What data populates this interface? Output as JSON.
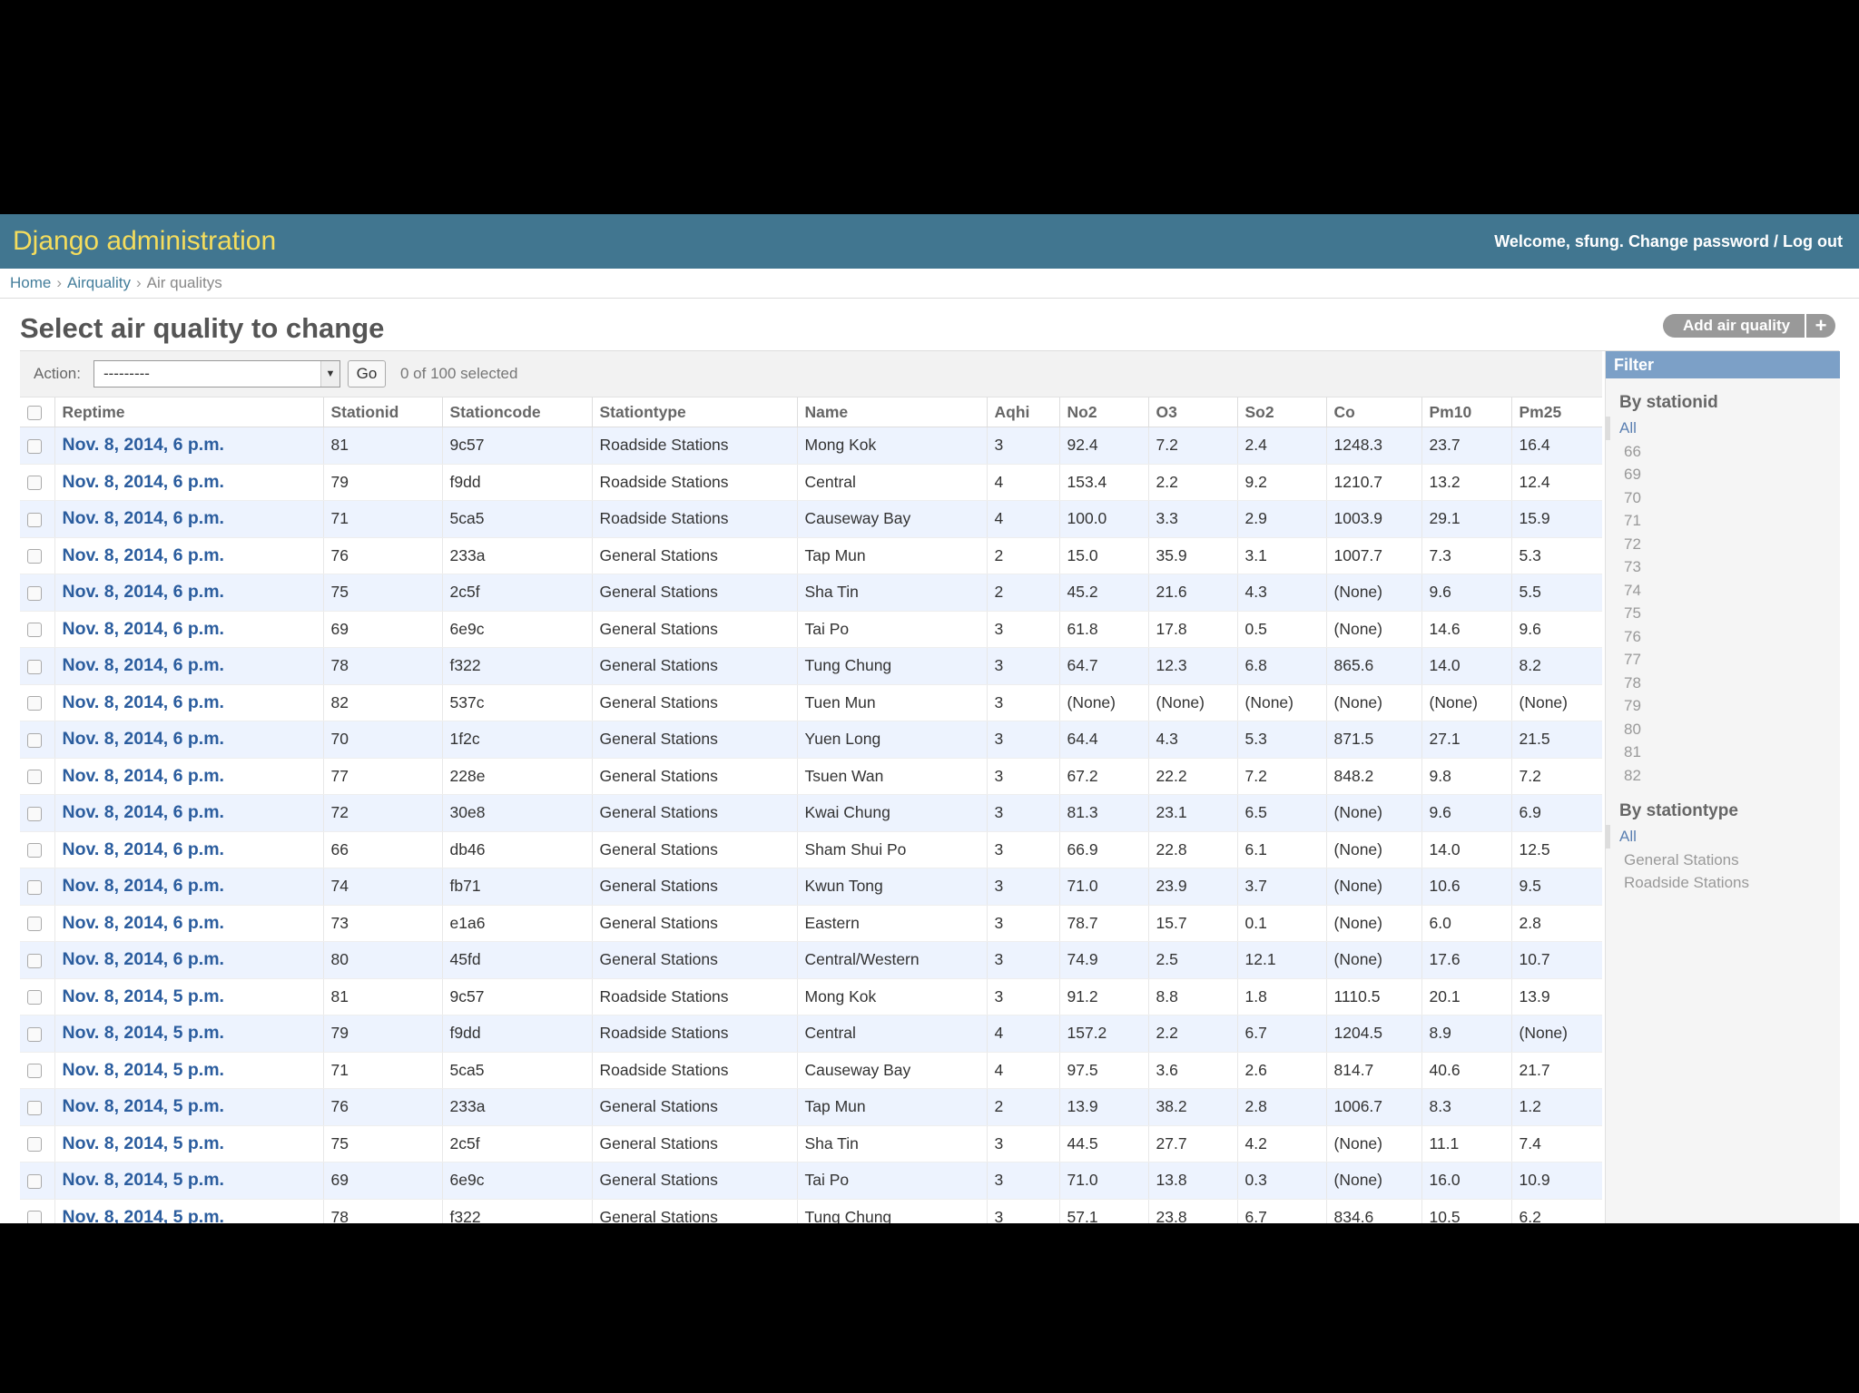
{
  "header": {
    "site_title": "Django administration",
    "welcome": "Welcome,",
    "username": "sfung",
    "change_password": "Change password",
    "separator": "/",
    "logout": "Log out"
  },
  "breadcrumbs": [
    "Home",
    "Airquality",
    "Air qualitys"
  ],
  "content": {
    "title": "Select air quality to change",
    "add_button": "Add air quality",
    "add_symbol": "+"
  },
  "actions": {
    "label": "Action:",
    "select_value": "---------",
    "go": "Go",
    "selected": "0 of 100 selected"
  },
  "table": {
    "columns": [
      "Reptime",
      "Stationid",
      "Stationcode",
      "Stationtype",
      "Name",
      "Aqhi",
      "No2",
      "O3",
      "So2",
      "Co",
      "Pm10",
      "Pm25"
    ],
    "rows": [
      [
        "Nov. 8, 2014, 6 p.m.",
        "81",
        "9c57",
        "Roadside Stations",
        "Mong Kok",
        "3",
        "92.4",
        "7.2",
        "2.4",
        "1248.3",
        "23.7",
        "16.4"
      ],
      [
        "Nov. 8, 2014, 6 p.m.",
        "79",
        "f9dd",
        "Roadside Stations",
        "Central",
        "4",
        "153.4",
        "2.2",
        "9.2",
        "1210.7",
        "13.2",
        "12.4"
      ],
      [
        "Nov. 8, 2014, 6 p.m.",
        "71",
        "5ca5",
        "Roadside Stations",
        "Causeway Bay",
        "4",
        "100.0",
        "3.3",
        "2.9",
        "1003.9",
        "29.1",
        "15.9"
      ],
      [
        "Nov. 8, 2014, 6 p.m.",
        "76",
        "233a",
        "General Stations",
        "Tap Mun",
        "2",
        "15.0",
        "35.9",
        "3.1",
        "1007.7",
        "7.3",
        "5.3"
      ],
      [
        "Nov. 8, 2014, 6 p.m.",
        "75",
        "2c5f",
        "General Stations",
        "Sha Tin",
        "2",
        "45.2",
        "21.6",
        "4.3",
        "(None)",
        "9.6",
        "5.5"
      ],
      [
        "Nov. 8, 2014, 6 p.m.",
        "69",
        "6e9c",
        "General Stations",
        "Tai Po",
        "3",
        "61.8",
        "17.8",
        "0.5",
        "(None)",
        "14.6",
        "9.6"
      ],
      [
        "Nov. 8, 2014, 6 p.m.",
        "78",
        "f322",
        "General Stations",
        "Tung Chung",
        "3",
        "64.7",
        "12.3",
        "6.8",
        "865.6",
        "14.0",
        "8.2"
      ],
      [
        "Nov. 8, 2014, 6 p.m.",
        "82",
        "537c",
        "General Stations",
        "Tuen Mun",
        "3",
        "(None)",
        "(None)",
        "(None)",
        "(None)",
        "(None)",
        "(None)"
      ],
      [
        "Nov. 8, 2014, 6 p.m.",
        "70",
        "1f2c",
        "General Stations",
        "Yuen Long",
        "3",
        "64.4",
        "4.3",
        "5.3",
        "871.5",
        "27.1",
        "21.5"
      ],
      [
        "Nov. 8, 2014, 6 p.m.",
        "77",
        "228e",
        "General Stations",
        "Tsuen Wan",
        "3",
        "67.2",
        "22.2",
        "7.2",
        "848.2",
        "9.8",
        "7.2"
      ],
      [
        "Nov. 8, 2014, 6 p.m.",
        "72",
        "30e8",
        "General Stations",
        "Kwai Chung",
        "3",
        "81.3",
        "23.1",
        "6.5",
        "(None)",
        "9.6",
        "6.9"
      ],
      [
        "Nov. 8, 2014, 6 p.m.",
        "66",
        "db46",
        "General Stations",
        "Sham Shui Po",
        "3",
        "66.9",
        "22.8",
        "6.1",
        "(None)",
        "14.0",
        "12.5"
      ],
      [
        "Nov. 8, 2014, 6 p.m.",
        "74",
        "fb71",
        "General Stations",
        "Kwun Tong",
        "3",
        "71.0",
        "23.9",
        "3.7",
        "(None)",
        "10.6",
        "9.5"
      ],
      [
        "Nov. 8, 2014, 6 p.m.",
        "73",
        "e1a6",
        "General Stations",
        "Eastern",
        "3",
        "78.7",
        "15.7",
        "0.1",
        "(None)",
        "6.0",
        "2.8"
      ],
      [
        "Nov. 8, 2014, 6 p.m.",
        "80",
        "45fd",
        "General Stations",
        "Central/Western",
        "3",
        "74.9",
        "2.5",
        "12.1",
        "(None)",
        "17.6",
        "10.7"
      ],
      [
        "Nov. 8, 2014, 5 p.m.",
        "81",
        "9c57",
        "Roadside Stations",
        "Mong Kok",
        "3",
        "91.2",
        "8.8",
        "1.8",
        "1110.5",
        "20.1",
        "13.9"
      ],
      [
        "Nov. 8, 2014, 5 p.m.",
        "79",
        "f9dd",
        "Roadside Stations",
        "Central",
        "4",
        "157.2",
        "2.2",
        "6.7",
        "1204.5",
        "8.9",
        "(None)"
      ],
      [
        "Nov. 8, 2014, 5 p.m.",
        "71",
        "5ca5",
        "Roadside Stations",
        "Causeway Bay",
        "4",
        "97.5",
        "3.6",
        "2.6",
        "814.7",
        "40.6",
        "21.7"
      ],
      [
        "Nov. 8, 2014, 5 p.m.",
        "76",
        "233a",
        "General Stations",
        "Tap Mun",
        "2",
        "13.9",
        "38.2",
        "2.8",
        "1006.7",
        "8.3",
        "1.2"
      ],
      [
        "Nov. 8, 2014, 5 p.m.",
        "75",
        "2c5f",
        "General Stations",
        "Sha Tin",
        "3",
        "44.5",
        "27.7",
        "4.2",
        "(None)",
        "11.1",
        "7.4"
      ],
      [
        "Nov. 8, 2014, 5 p.m.",
        "69",
        "6e9c",
        "General Stations",
        "Tai Po",
        "3",
        "71.0",
        "13.8",
        "0.3",
        "(None)",
        "16.0",
        "10.9"
      ],
      [
        "Nov. 8, 2014, 5 p.m.",
        "78",
        "f322",
        "General Stations",
        "Tung Chung",
        "3",
        "57.1",
        "23.8",
        "6.7",
        "834.6",
        "10.5",
        "6.2"
      ]
    ]
  },
  "filter": {
    "title": "Filter",
    "groups": [
      {
        "heading": "By stationid",
        "items": [
          "All",
          "66",
          "69",
          "70",
          "71",
          "72",
          "73",
          "74",
          "75",
          "76",
          "77",
          "78",
          "79",
          "80",
          "81",
          "82"
        ],
        "selected": "All"
      },
      {
        "heading": "By stationtype",
        "items": [
          "All",
          "General Stations",
          "Roadside Stations"
        ],
        "selected": "All"
      }
    ]
  },
  "colors": {
    "header_bg": "#417690",
    "title_yellow": "#f5dd5d",
    "link_blue": "#2b5d9e",
    "row_alt": "#edf3fe",
    "filter_header": "#7ca0c7"
  }
}
